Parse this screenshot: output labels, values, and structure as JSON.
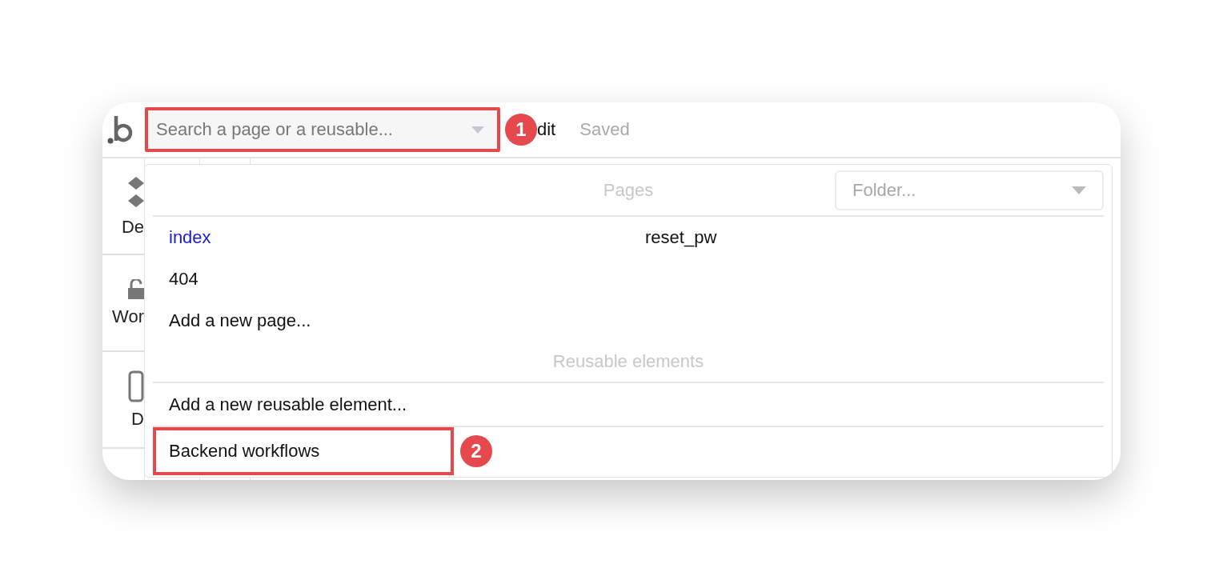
{
  "topbar": {
    "search": {
      "placeholder": "Search a page or a reusable...",
      "highlighted": true,
      "badge": "1"
    },
    "edit_label": "dit",
    "status": "Saved"
  },
  "sidebar": {
    "items": [
      {
        "label": "De",
        "kind": "design"
      },
      {
        "label": "Wor",
        "kind": "workflow"
      },
      {
        "label": "D",
        "kind": "data"
      }
    ]
  },
  "dropdown": {
    "pages_heading": "Pages",
    "folder": {
      "placeholder": "Folder..."
    },
    "pages": [
      {
        "label": "index",
        "current": true
      },
      {
        "label": "reset_pw",
        "current": false
      },
      {
        "label": "404",
        "current": false
      }
    ],
    "add_page": "Add a new page...",
    "reusables_heading": "Reusable elements",
    "add_reusable": "Add a new reusable element...",
    "backend": {
      "label": "Backend workflows",
      "highlighted": true,
      "badge": "2"
    }
  }
}
